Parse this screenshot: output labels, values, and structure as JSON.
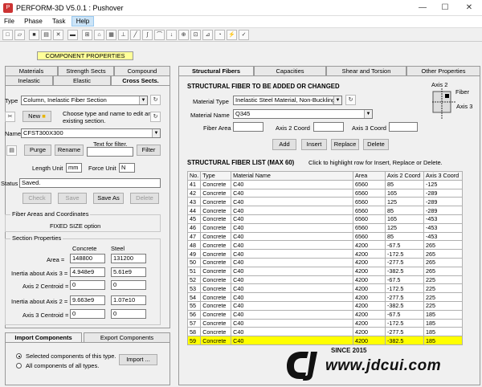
{
  "window": {
    "title": "PERFORM-3D V5.0.1 : Pushover",
    "minimize": "—",
    "maximize": "☐",
    "close": "✕"
  },
  "menu": [
    "File",
    "Phase",
    "Task",
    "Help"
  ],
  "left": {
    "banner": "COMPONENT PROPERTIES",
    "tabs_row1": [
      "Materials",
      "Strength Sects",
      "Compound"
    ],
    "tabs_row2": [
      "Inelastic",
      "Elastic",
      "Cross Sects."
    ],
    "type_label": "Type",
    "type_value": "Column, Inelastic Fiber Section",
    "new_label": "New",
    "new_hint": "Choose type and name to edit an existing section.",
    "name_label": "Name",
    "name_value": "CFST300X300",
    "filter_hint": "Text for filter.",
    "purge": "Purge",
    "rename": "Rename",
    "filter": "Filter",
    "length_unit_label": "Length Unit",
    "length_unit": "mm",
    "force_unit_label": "Force Unit",
    "force_unit": "N",
    "status_label": "Status",
    "status_value": "Saved.",
    "check": "Check",
    "save": "Save",
    "save_as": "Save As",
    "delete": "Delete",
    "fiber_group_title": "Fiber Areas and Coordinates",
    "fiber_group_text": "FIXED SIZE option",
    "props_group_title": "Section Properties",
    "col_concrete": "Concrete",
    "col_steel": "Steel",
    "props": [
      {
        "label": "Area =",
        "concrete": "148800",
        "steel": "131200"
      },
      {
        "label": "Inertia about Axis 3 =",
        "concrete": "4.948e9",
        "steel": "5.61e9"
      },
      {
        "label": "Axis 2 Centroid =",
        "concrete": "0",
        "steel": "0"
      },
      {
        "label": "Inertia about Axis 2 =",
        "concrete": "9.663e9",
        "steel": "1.07e10"
      },
      {
        "label": "Axis 3 Centroid =",
        "concrete": "0",
        "steel": "0"
      }
    ],
    "bottom_tabs": [
      "Import Components",
      "Export Components"
    ],
    "radio_selected": "Selected components of this type.",
    "radio_all": "All components of all types.",
    "import_btn": "Import ..."
  },
  "right": {
    "tabs": [
      "Structural Fibers",
      "Capacities",
      "Shear and Torsion",
      "Other Properties"
    ],
    "add_title": "STRUCTURAL FIBER TO BE ADDED OR CHANGED",
    "material_type_label": "Material Type",
    "material_type_value": "Inelastic Steel Material, Non-Buckling",
    "material_name_label": "Material Name",
    "material_name_value": "Q345",
    "fiber_area_label": "Fiber Area",
    "axis2_label": "Axis 2 Coord",
    "axis3_label": "Axis 3 Coord",
    "add": "Add",
    "insert": "Insert",
    "replace": "Replace",
    "delete": "Delete",
    "diagram_axis2": "Axis 2",
    "diagram_fiber": "Fiber",
    "diagram_axis3": "Axis 3",
    "list_title": "STRUCTURAL FIBER LIST  (MAX 60)",
    "list_hint": "Click to highlight row for Insert, Replace or Delete.",
    "columns": [
      "No.",
      "Type",
      "Material Name",
      "Area",
      "Axis 2 Coord",
      "Axis 3 Coord"
    ],
    "rows": [
      [
        "41",
        "Concrete",
        "C40",
        "6560",
        "85",
        "-125"
      ],
      [
        "42",
        "Concrete",
        "C40",
        "6560",
        "165",
        "-289"
      ],
      [
        "43",
        "Concrete",
        "C40",
        "6560",
        "125",
        "-289"
      ],
      [
        "44",
        "Concrete",
        "C40",
        "6560",
        "85",
        "-289"
      ],
      [
        "45",
        "Concrete",
        "C40",
        "6560",
        "165",
        "-453"
      ],
      [
        "46",
        "Concrete",
        "C40",
        "6560",
        "125",
        "-453"
      ],
      [
        "47",
        "Concrete",
        "C40",
        "6560",
        "85",
        "-453"
      ],
      [
        "48",
        "Concrete",
        "C40",
        "4200",
        "-67.5",
        "265"
      ],
      [
        "49",
        "Concrete",
        "C40",
        "4200",
        "-172.5",
        "265"
      ],
      [
        "50",
        "Concrete",
        "C40",
        "4200",
        "-277.5",
        "265"
      ],
      [
        "51",
        "Concrete",
        "C40",
        "4200",
        "-382.5",
        "265"
      ],
      [
        "52",
        "Concrete",
        "C40",
        "4200",
        "-67.5",
        "225"
      ],
      [
        "53",
        "Concrete",
        "C40",
        "4200",
        "-172.5",
        "225"
      ],
      [
        "54",
        "Concrete",
        "C40",
        "4200",
        "-277.5",
        "225"
      ],
      [
        "55",
        "Concrete",
        "C40",
        "4200",
        "-382.5",
        "225"
      ],
      [
        "56",
        "Concrete",
        "C40",
        "4200",
        "-67.5",
        "185"
      ],
      [
        "57",
        "Concrete",
        "C40",
        "4200",
        "-172.5",
        "185"
      ],
      [
        "58",
        "Concrete",
        "C40",
        "4200",
        "-277.5",
        "185"
      ],
      [
        "59",
        "Concrete",
        "C40",
        "4200",
        "-382.5",
        "185"
      ]
    ],
    "highlight_row": "59"
  },
  "watermark": {
    "since": "SINCE 2015",
    "url": "www.jdcui.com"
  }
}
